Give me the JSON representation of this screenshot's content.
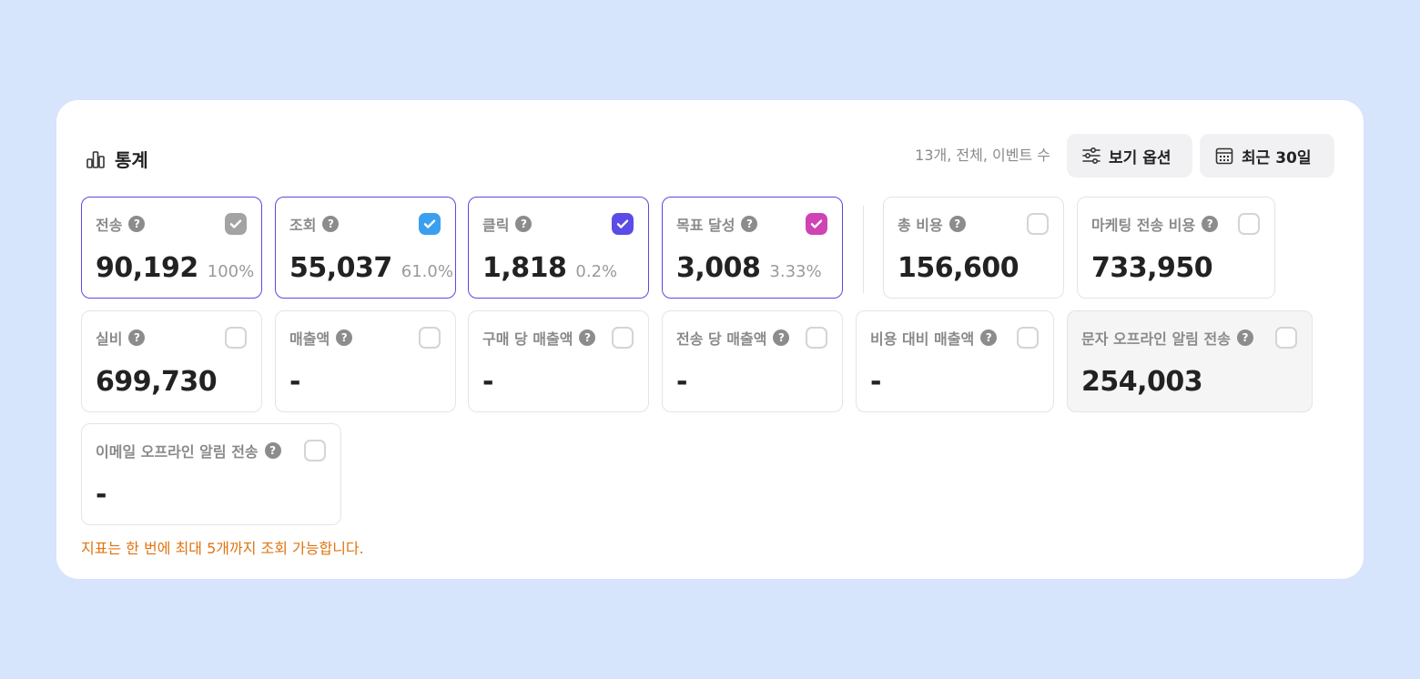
{
  "header": {
    "title": "통계",
    "summary": "13개, 전체, 이벤트 수",
    "view_options_label": "보기 옵션",
    "date_range_label": "최근 30일"
  },
  "metrics": [
    {
      "label": "전송",
      "value": "90,192",
      "percent": "100%",
      "checked": true,
      "check_color": "#a3a3a3",
      "selected": true
    },
    {
      "label": "조회",
      "value": "55,037",
      "percent": "61.0%",
      "checked": true,
      "check_color": "#3a9fef",
      "selected": true
    },
    {
      "label": "클릭",
      "value": "1,818",
      "percent": "0.2%",
      "checked": true,
      "check_color": "#5b4ce8",
      "selected": true
    },
    {
      "label": "목표 달성",
      "value": "3,008",
      "percent": "3.33%",
      "checked": true,
      "check_color": "#cf43b5",
      "selected": true
    },
    {
      "label": "총 비용",
      "value": "156,600",
      "checked": false
    },
    {
      "label": "마케팅 전송 비용",
      "value": "733,950",
      "checked": false
    },
    {
      "label": "실비",
      "value": "699,730",
      "checked": false
    },
    {
      "label": "매출액",
      "value": "-",
      "checked": false
    },
    {
      "label": "구매 당 매출액",
      "value": "-",
      "checked": false
    },
    {
      "label": "전송 당 매출액",
      "value": "-",
      "checked": false
    },
    {
      "label": "비용 대비 매출액",
      "value": "-",
      "checked": false
    },
    {
      "label": "문자 오프라인 알림 전송",
      "value": "254,003",
      "checked": false,
      "disabled": true
    },
    {
      "label": "이메일 오프라인 알림 전송",
      "value": "-",
      "checked": false
    }
  ],
  "notice": "지표는 한 번에 최대 5개까지 조회 가능합니다.",
  "colors": {
    "page_background": "#d6e4fc",
    "selected_border": "#5b49e0",
    "notice": "#e07410"
  },
  "icons": {
    "title": "bar-chart-icon",
    "view_options": "sliders-icon",
    "date_range": "calendar-icon",
    "help": "question-circle-icon",
    "check": "check-icon"
  }
}
